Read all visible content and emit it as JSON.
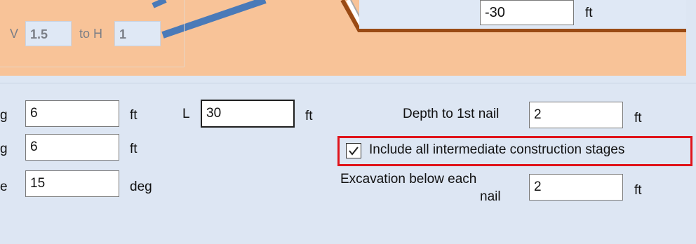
{
  "diagram": {
    "slope_v_label": "V",
    "slope_v_value": "1.5",
    "slope_to_h_label": "to H",
    "slope_h_value": "1",
    "depth_value": "-30",
    "depth_unit": "ft",
    "colors": {
      "soil": "#f8c398",
      "nail": "#4a7ab8",
      "ground_line": "#9a4a14"
    }
  },
  "form": {
    "row1": {
      "label_fragment": "g",
      "value": "6",
      "unit": "ft"
    },
    "row2": {
      "label_fragment": "g",
      "value": "6",
      "unit": "ft"
    },
    "row3": {
      "label_fragment": "e",
      "value": "15",
      "unit": "deg"
    },
    "length": {
      "label": "L",
      "value": "30",
      "unit": "ft"
    },
    "depth_first_nail": {
      "label": "Depth to 1st nail",
      "value": "2",
      "unit": "ft"
    },
    "include_stages": {
      "label": "Include all intermediate construction stages",
      "checked": true
    },
    "excavation": {
      "label_line1": "Excavation below each",
      "label_line2": "nail",
      "value": "2",
      "unit": "ft"
    }
  },
  "colors": {
    "panel_bg": "#dde6f3",
    "highlight": "#e0131a"
  }
}
